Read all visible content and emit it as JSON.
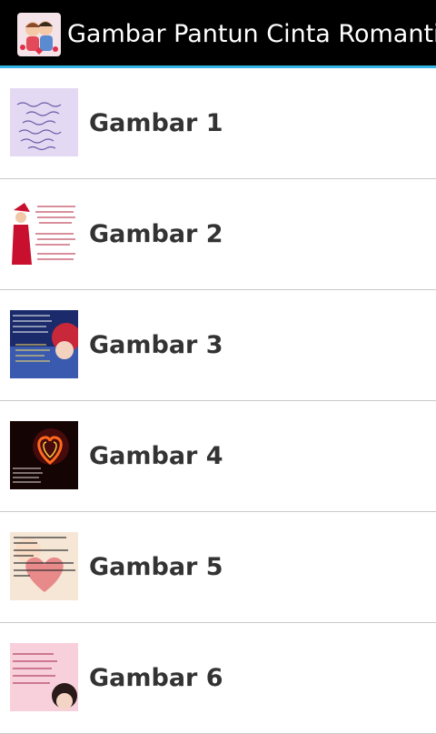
{
  "app": {
    "title": "Gambar Pantun Cinta Romantis",
    "icon": "couple-hearts-icon"
  },
  "accent_color": "#33b5e5",
  "items": [
    {
      "label": "Gambar 1",
      "thumb": "lavender-quote-image"
    },
    {
      "label": "Gambar 2",
      "thumb": "red-dress-girl-quote-image"
    },
    {
      "label": "Gambar 3",
      "thumb": "blue-anime-girl-quote-image"
    },
    {
      "label": "Gambar 4",
      "thumb": "glowing-heart-image"
    },
    {
      "label": "Gambar 5",
      "thumb": "peach-heart-quote-image"
    },
    {
      "label": "Gambar 6",
      "thumb": "pink-anime-girl-quote-image"
    }
  ]
}
